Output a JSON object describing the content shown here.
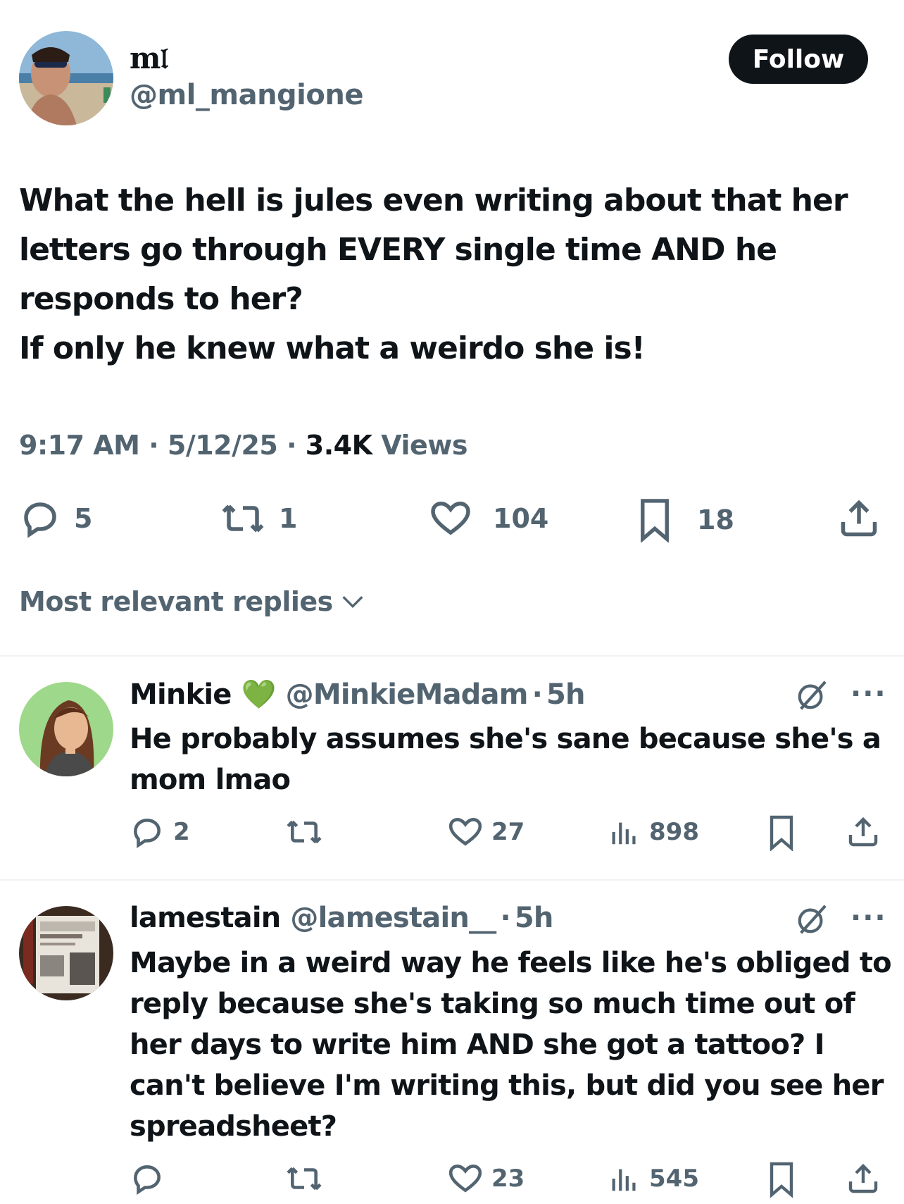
{
  "tweet": {
    "display_name": "m𝔩",
    "handle": "@ml_mangione",
    "follow_label": "Follow",
    "text_lines": [
      "What the hell is jules even writing about that her",
      "letters go through EVERY single time AND he",
      "responds to her?",
      "If only he knew what a weirdo she is!"
    ],
    "time": "9:17 AM",
    "date": "5/12/25",
    "separator": "·",
    "views_count": "3.4K",
    "views_label": "Views",
    "stats": {
      "replies": "5",
      "reposts": "1",
      "likes": "104",
      "bookmarks": "18"
    }
  },
  "replies_sort": {
    "label": "Most relevant replies"
  },
  "replies": [
    {
      "name": "Minkie",
      "badge": "💚",
      "handle": "@MinkieMadam",
      "time": "5h",
      "separator": "·",
      "text_lines": [
        "He probably assumes she's sane because she's a",
        "mom lmao"
      ],
      "stats": {
        "replies": "2",
        "reposts": "",
        "likes": "27",
        "views": "898"
      }
    },
    {
      "name": "lamestain",
      "handle": "@lamestain__",
      "time": "5h",
      "separator": "·",
      "text_lines": [
        "Maybe in a weird way he feels like he's obliged to",
        "reply because she's taking so much time out of",
        "her days to write him AND she got a tattoo? I",
        "can't believe I'm writing this, but did you see her",
        "spreadsheet?"
      ],
      "stats": {
        "replies": "",
        "reposts": "",
        "likes": "23",
        "views": "545"
      }
    }
  ],
  "more_label": "···",
  "colors": {
    "text": "#0f1419",
    "secondary": "#536471",
    "button_bg": "#0f1419",
    "divider": "#eff3f4"
  }
}
